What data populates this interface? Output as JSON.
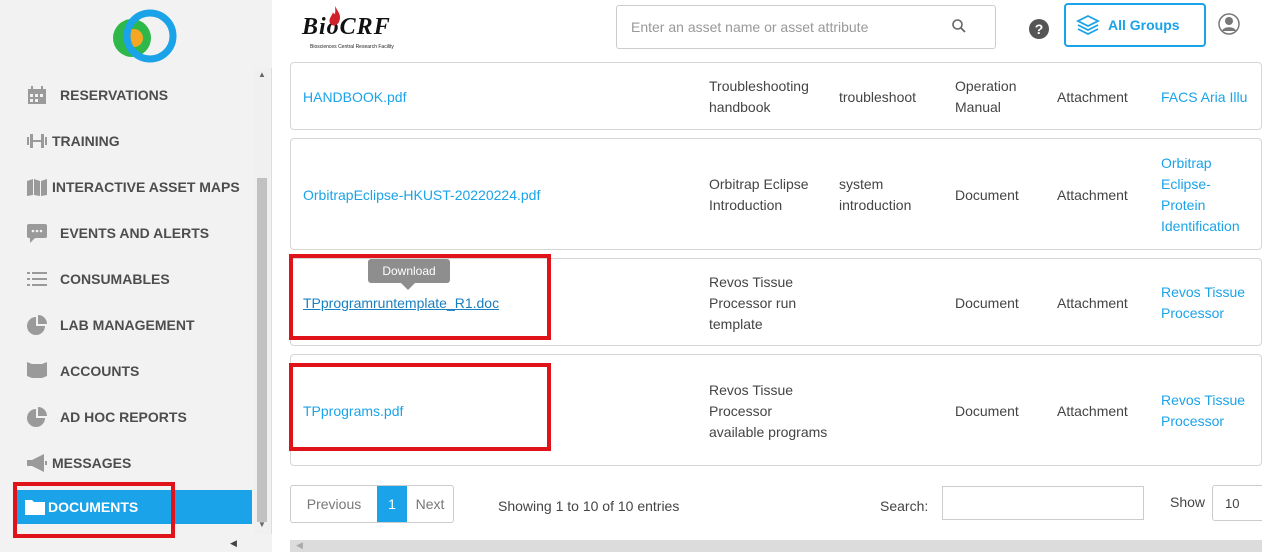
{
  "brand": {
    "name": "BioCRF",
    "subtitle": "Biosciences Central Research Facility",
    "logo_colors": [
      "#1aa3e8",
      "#2fb84a",
      "#f5a623"
    ]
  },
  "search": {
    "placeholder": "Enter an asset name or asset attribute",
    "icon": "search-icon"
  },
  "header": {
    "help_icon": "question-icon",
    "groups_label": "All Groups",
    "groups_icon": "layers-icon",
    "avatar_icon": "user-icon"
  },
  "sidebar": {
    "items": [
      {
        "label": "RESERVATIONS",
        "icon": "calendar-icon"
      },
      {
        "label": "TRAINING",
        "icon": "dumbbell-icon"
      },
      {
        "label": "INTERACTIVE ASSET MAPS",
        "icon": "map-icon"
      },
      {
        "label": "EVENTS AND ALERTS",
        "icon": "chat-icon"
      },
      {
        "label": "CONSUMABLES",
        "icon": "list-icon"
      },
      {
        "label": "LAB MANAGEMENT",
        "icon": "pie-chart-icon"
      },
      {
        "label": "ACCOUNTS",
        "icon": "flag-icon"
      },
      {
        "label": "AD HOC REPORTS",
        "icon": "pie-chart-icon"
      },
      {
        "label": "MESSAGES",
        "icon": "megaphone-icon"
      },
      {
        "label": "DOCUMENTS",
        "icon": "folder-icon",
        "active": true
      }
    ]
  },
  "table": {
    "rows": [
      {
        "file": "HANDBOOK.pdf",
        "description": "Troubleshooting handbook",
        "tag": "troubleshoot",
        "type": "Operation Manual",
        "kind": "Attachment",
        "asset": "FACS Aria Illu"
      },
      {
        "file": "OrbitrapEclipse-HKUST-20220224.pdf",
        "description": "Orbitrap Eclipse Introduction",
        "tag": "system introduction",
        "type": "Document",
        "kind": "Attachment",
        "asset": "Orbitrap Eclipse- Protein Identification"
      },
      {
        "file": "TPprogramruntemplate_R1.doc",
        "description": "Revos Tissue Processor run template",
        "tag": "",
        "type": "Document",
        "kind": "Attachment",
        "asset": "Revos Tissue Processor"
      },
      {
        "file": "TPprograms.pdf",
        "description": "Revos Tissue Processor available programs",
        "tag": "",
        "type": "Document",
        "kind": "Attachment",
        "asset": "Revos Tissue Processor"
      }
    ],
    "tooltip": "Download"
  },
  "footer": {
    "prev": "Previous",
    "page": "1",
    "next": "Next",
    "showing": "Showing 1 to 10 of 10 entries",
    "search_label": "Search:",
    "show_label": "Show",
    "page_size": "10"
  }
}
